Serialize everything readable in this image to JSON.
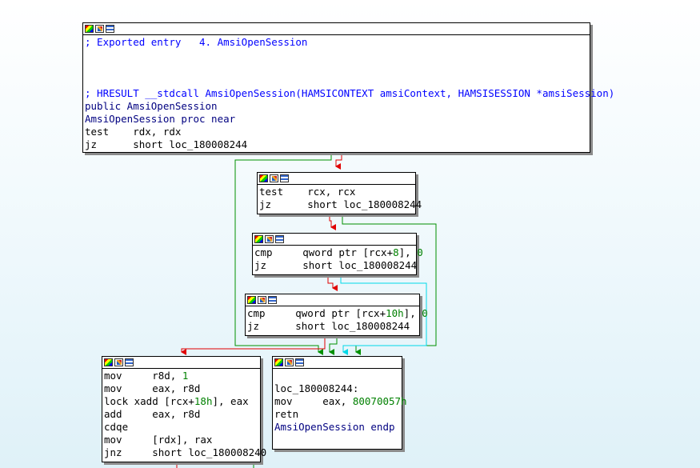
{
  "graph": {
    "colors": {
      "taken_edge": "#009000",
      "fallthrough_edge": "#e00000",
      "jump_edge": "#00e0e0",
      "block_shadow": "#8a8a8a"
    },
    "blocks": [
      {
        "id": "entry",
        "lines": [
          [
            {
              "t": "; Exported entry   4. AmsiOpenSession",
              "c": "cm"
            }
          ],
          [],
          [],
          [],
          [
            {
              "t": "; HRESULT __stdcall AmsiOpenSession(HAMSICONTEXT amsiContext, HAMSISESSION *amsiSession)",
              "c": "cm"
            }
          ],
          [
            {
              "t": "public AmsiOpenSession",
              "c": "kw"
            }
          ],
          [
            {
              "t": "AmsiOpenSession proc near",
              "c": "kw"
            }
          ],
          [
            {
              "t": "test    rdx, rdx",
              "c": "blk"
            }
          ],
          [
            {
              "t": "jz      short loc_180008244",
              "c": "blk"
            }
          ]
        ]
      },
      {
        "id": "b2",
        "lines": [
          [
            {
              "t": "test    rcx, rcx",
              "c": "blk"
            }
          ],
          [
            {
              "t": "jz      short loc_180008244",
              "c": "blk"
            }
          ]
        ]
      },
      {
        "id": "b3",
        "lines": [
          [
            {
              "t": "cmp     qword ptr [rcx+",
              "c": "blk"
            },
            {
              "t": "8",
              "c": "num"
            },
            {
              "t": "], ",
              "c": "blk"
            },
            {
              "t": "0",
              "c": "num"
            }
          ],
          [
            {
              "t": "jz      short loc_180008244",
              "c": "blk"
            }
          ]
        ]
      },
      {
        "id": "b4",
        "lines": [
          [
            {
              "t": "cmp     qword ptr [rcx+",
              "c": "blk"
            },
            {
              "t": "10h",
              "c": "num"
            },
            {
              "t": "], ",
              "c": "blk"
            },
            {
              "t": "0",
              "c": "num"
            }
          ],
          [
            {
              "t": "jz      short loc_180008244",
              "c": "blk"
            }
          ]
        ]
      },
      {
        "id": "b5",
        "lines": [
          [
            {
              "t": "mov     r8d, ",
              "c": "blk"
            },
            {
              "t": "1",
              "c": "num"
            }
          ],
          [
            {
              "t": "mov     eax, r8d",
              "c": "blk"
            }
          ],
          [
            {
              "t": "lock xadd [rcx+",
              "c": "blk"
            },
            {
              "t": "18h",
              "c": "num"
            },
            {
              "t": "], eax",
              "c": "blk"
            }
          ],
          [
            {
              "t": "add     eax, r8d",
              "c": "blk"
            }
          ],
          [
            {
              "t": "cdqe",
              "c": "blk"
            }
          ],
          [
            {
              "t": "mov     [rdx], rax",
              "c": "blk"
            }
          ],
          [
            {
              "t": "jnz     short loc_180008240",
              "c": "blk"
            }
          ]
        ]
      },
      {
        "id": "b6",
        "lines": [
          [],
          [
            {
              "t": "loc_180008244:",
              "c": "blk"
            }
          ],
          [
            {
              "t": "mov     eax, ",
              "c": "blk"
            },
            {
              "t": "80070057h",
              "c": "num"
            }
          ],
          [
            {
              "t": "retn",
              "c": "blk"
            }
          ],
          [
            {
              "t": "AmsiOpenSession endp",
              "c": "kw"
            }
          ]
        ]
      }
    ]
  }
}
